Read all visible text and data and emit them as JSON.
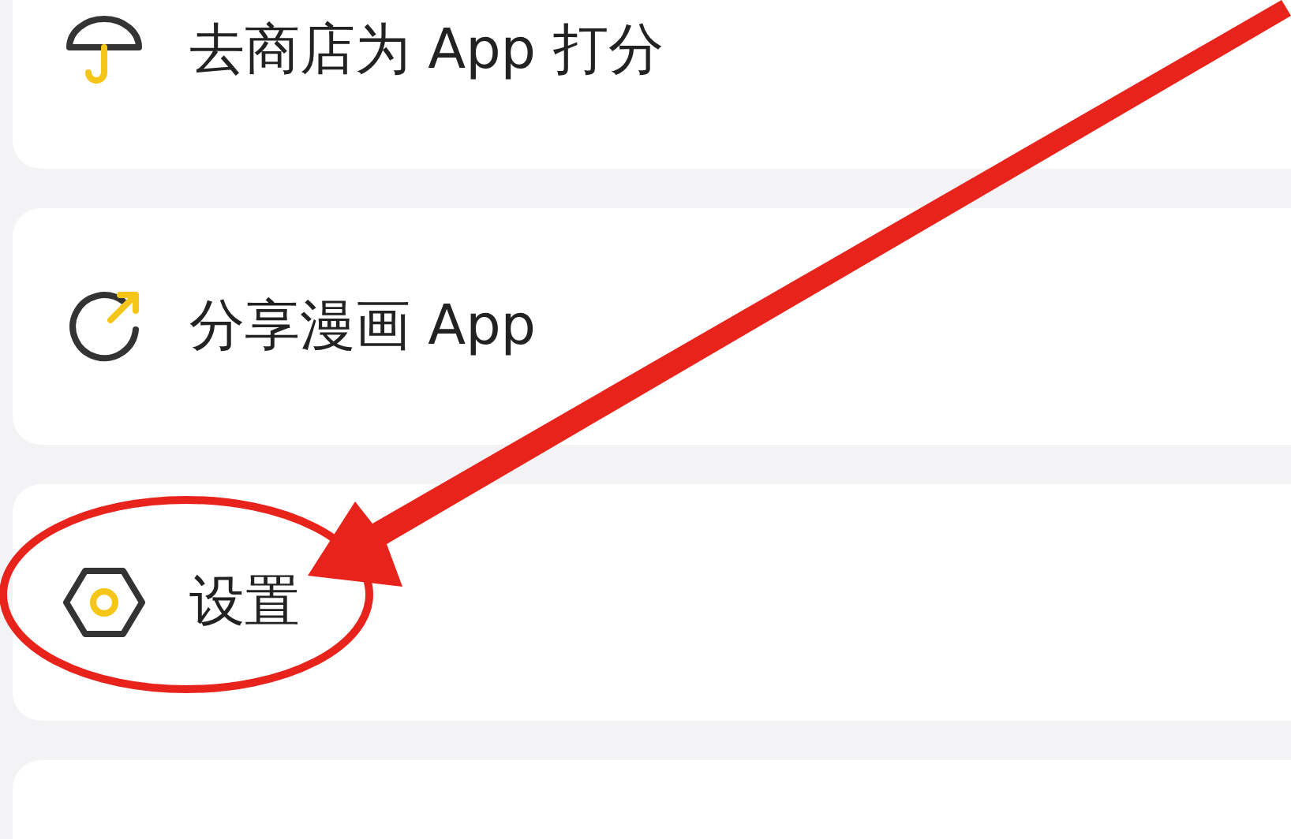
{
  "menu_items": [
    {
      "kind": "umbrella",
      "label": "去商店为 App 打分"
    },
    {
      "kind": "share",
      "label": "分享漫画 App"
    },
    {
      "kind": "settings",
      "label": "设置"
    },
    {
      "kind": "blank"
    }
  ],
  "highlight_ellipse": {
    "color": "#e8231c"
  },
  "pointer_arrow": {
    "color": "#e8231c"
  }
}
